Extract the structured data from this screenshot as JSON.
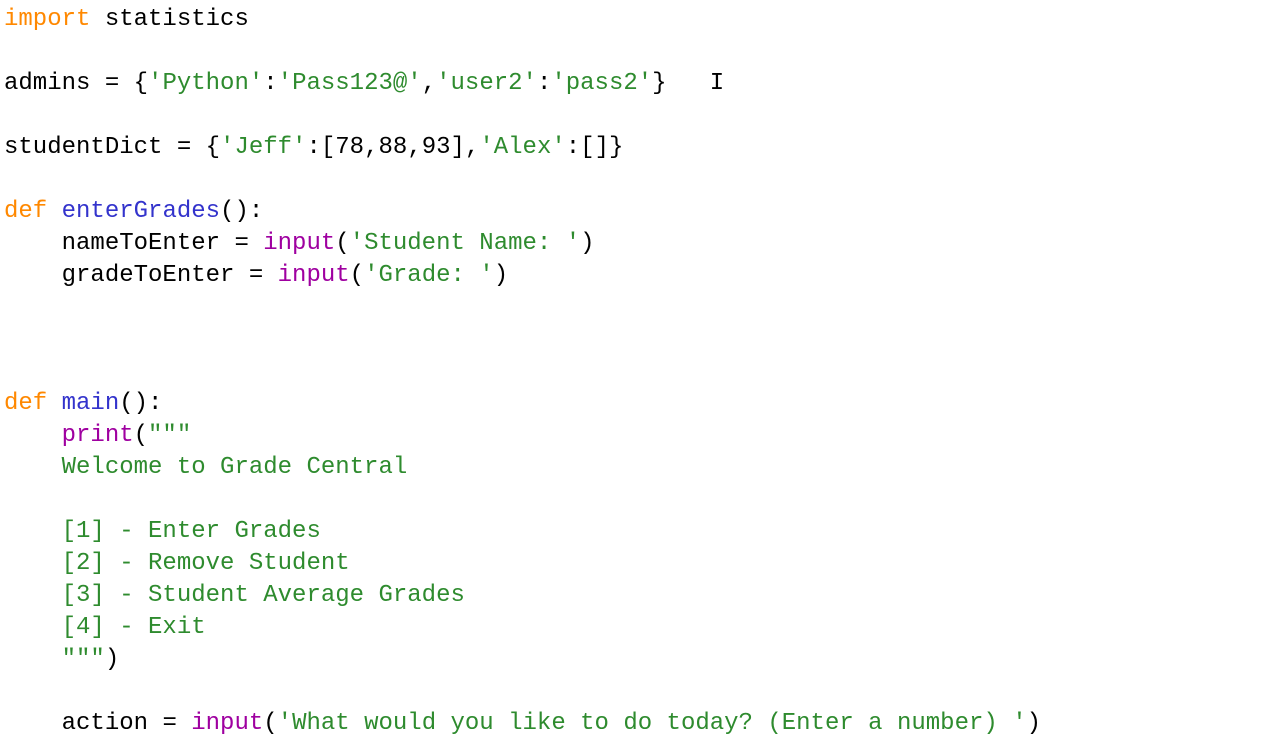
{
  "tokens": {
    "kw_import": "import",
    "t_statistics": " statistics",
    "t_admins": "admins ",
    "t_eq": "= ",
    "t_lbrace": "{",
    "s_python": "'Python'",
    "t_colon": ":",
    "s_pass123": "'Pass123@'",
    "t_comma": ",",
    "s_user2": "'user2'",
    "s_pass2": "'pass2'",
    "t_rbrace": "}",
    "t_cursor": "   I",
    "t_studentDict": "studentDict ",
    "s_jeff": "'Jeff'",
    "t_lbrack": "[",
    "n78": "78",
    "n88": "88",
    "n93": "93",
    "t_rbrack": "]",
    "s_alex": "'Alex'",
    "kw_def": "def",
    "fn_enterGrades": " enterGrades",
    "t_parens_colon": "():",
    "t_indent_name": "    nameToEnter ",
    "fn_input": "input",
    "t_lparen": "(",
    "s_studentname": "'Student Name: '",
    "t_rparen": ")",
    "t_indent_grade": "    gradeToEnter ",
    "s_grade": "'Grade: '",
    "fn_main": " main",
    "t_indent": "    ",
    "fn_print": "print",
    "s_triple_open": "\"\"\"",
    "s_welcome": "    Welcome to Grade Central",
    "s_blank": "",
    "s_opt1": "    [1] - Enter Grades",
    "s_opt2": "    [2] - Remove Student",
    "s_opt3": "    [3] - Student Average Grades",
    "s_opt4": "    [4] - Exit",
    "s_triple_close_indent": "    \"\"\"",
    "t_indent_action": "    action ",
    "s_whatwould": "'What would you like to do today? (Enter a number) '"
  }
}
